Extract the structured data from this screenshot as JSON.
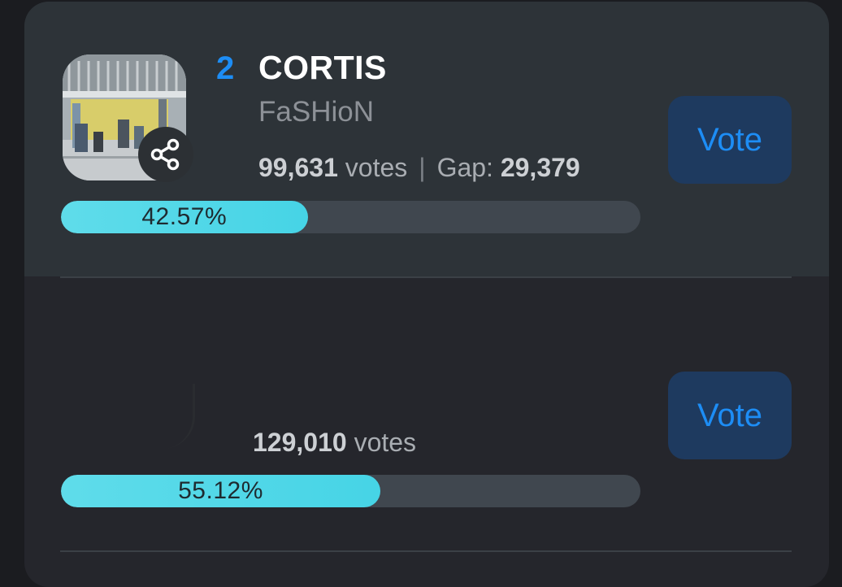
{
  "entries": [
    {
      "rank": "2",
      "artist": "CORTIS",
      "song": "FaSHioN",
      "votes_number": "99,631",
      "votes_word": "votes",
      "gap_label": "Gap:",
      "gap_value": "29,379",
      "percent_label": "42.57%",
      "percent": 42.57,
      "vote_label": "Vote"
    },
    {
      "votes_number": "129,010",
      "votes_word": "votes",
      "percent_label": "55.12%",
      "percent": 55.12,
      "vote_label": "Vote"
    }
  ],
  "icons": {
    "share": "share-icon"
  },
  "colors": {
    "accent": "#1d8df5",
    "progress": "#46d4e6",
    "vote_button_bg": "#1e3a5f"
  }
}
